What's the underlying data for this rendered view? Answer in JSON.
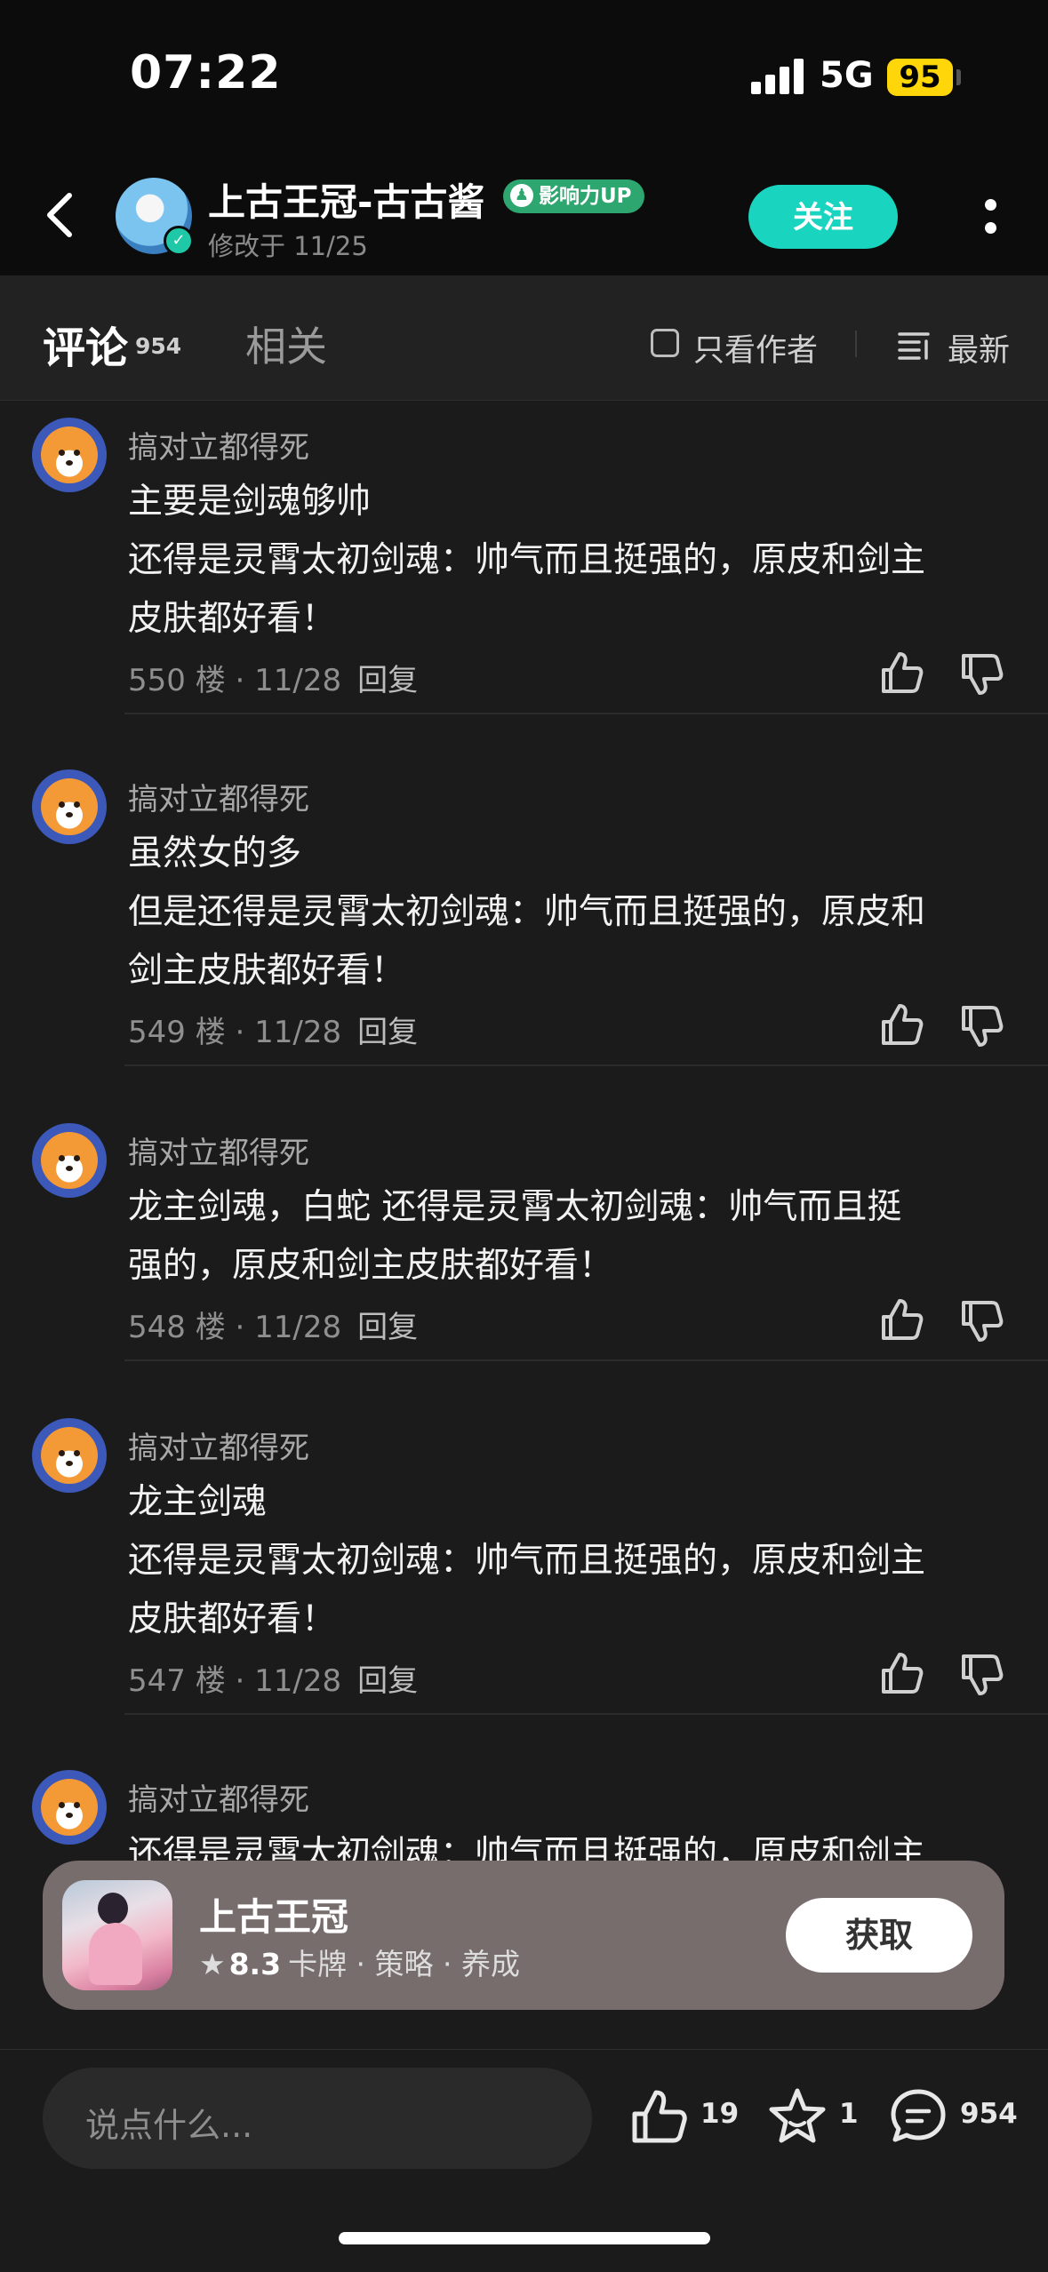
{
  "status_bar": {
    "time": "07:22",
    "network": "5G",
    "battery": "95"
  },
  "header": {
    "author_name": "上古王冠-古古酱",
    "badge": "影响力UP",
    "modified": "修改于 11/25",
    "follow_label": "关注"
  },
  "tabs": {
    "comments_label": "评论",
    "comments_count": "954",
    "related_label": "相关",
    "author_only_label": "只看作者",
    "sort_label": "最新"
  },
  "comments": [
    {
      "user": "搞对立都得死",
      "lines": [
        "主要是剑魂够帅",
        "还得是灵霄太初剑魂：帅气而且挺强的，原皮和剑主",
        "皮肤都好看！"
      ],
      "floor": "550 楼",
      "date": "11/28",
      "reply": "回复"
    },
    {
      "user": "搞对立都得死",
      "lines": [
        "虽然女的多",
        "但是还得是灵霄太初剑魂：帅气而且挺强的，原皮和",
        "剑主皮肤都好看！"
      ],
      "floor": "549 楼",
      "date": "11/28",
      "reply": "回复"
    },
    {
      "user": "搞对立都得死",
      "lines": [
        "龙主剑魂，白蛇 还得是灵霄太初剑魂：帅气而且挺",
        "强的，原皮和剑主皮肤都好看！"
      ],
      "floor": "548 楼",
      "date": "11/28",
      "reply": "回复"
    },
    {
      "user": "搞对立都得死",
      "lines": [
        "龙主剑魂",
        "还得是灵霄太初剑魂：帅气而且挺强的，原皮和剑主",
        "皮肤都好看！"
      ],
      "floor": "547 楼",
      "date": "11/28",
      "reply": "回复"
    },
    {
      "user": "搞对立都得死",
      "lines": [
        "还得是灵霄太初剑魂：帅气而且挺强的，原皮和剑主"
      ],
      "floor": "",
      "date": "",
      "reply": ""
    }
  ],
  "game_card": {
    "name": "上古王冠",
    "rating": "8.3",
    "tags": "卡牌 · 策略 · 养成",
    "button": "获取"
  },
  "bottom_bar": {
    "input_placeholder": "说点什么...",
    "likes": "19",
    "favorites": "1",
    "comments": "954"
  },
  "colors": {
    "accent": "#19d5c0",
    "background": "#1b1b1b",
    "badge_green": "#2ea66f",
    "battery": "#ffd60a"
  },
  "icons": [
    "back-icon",
    "more-icon",
    "sort-icon",
    "thumb-up-icon",
    "thumb-down-icon",
    "like-icon",
    "star-icon",
    "comment-icon"
  ]
}
